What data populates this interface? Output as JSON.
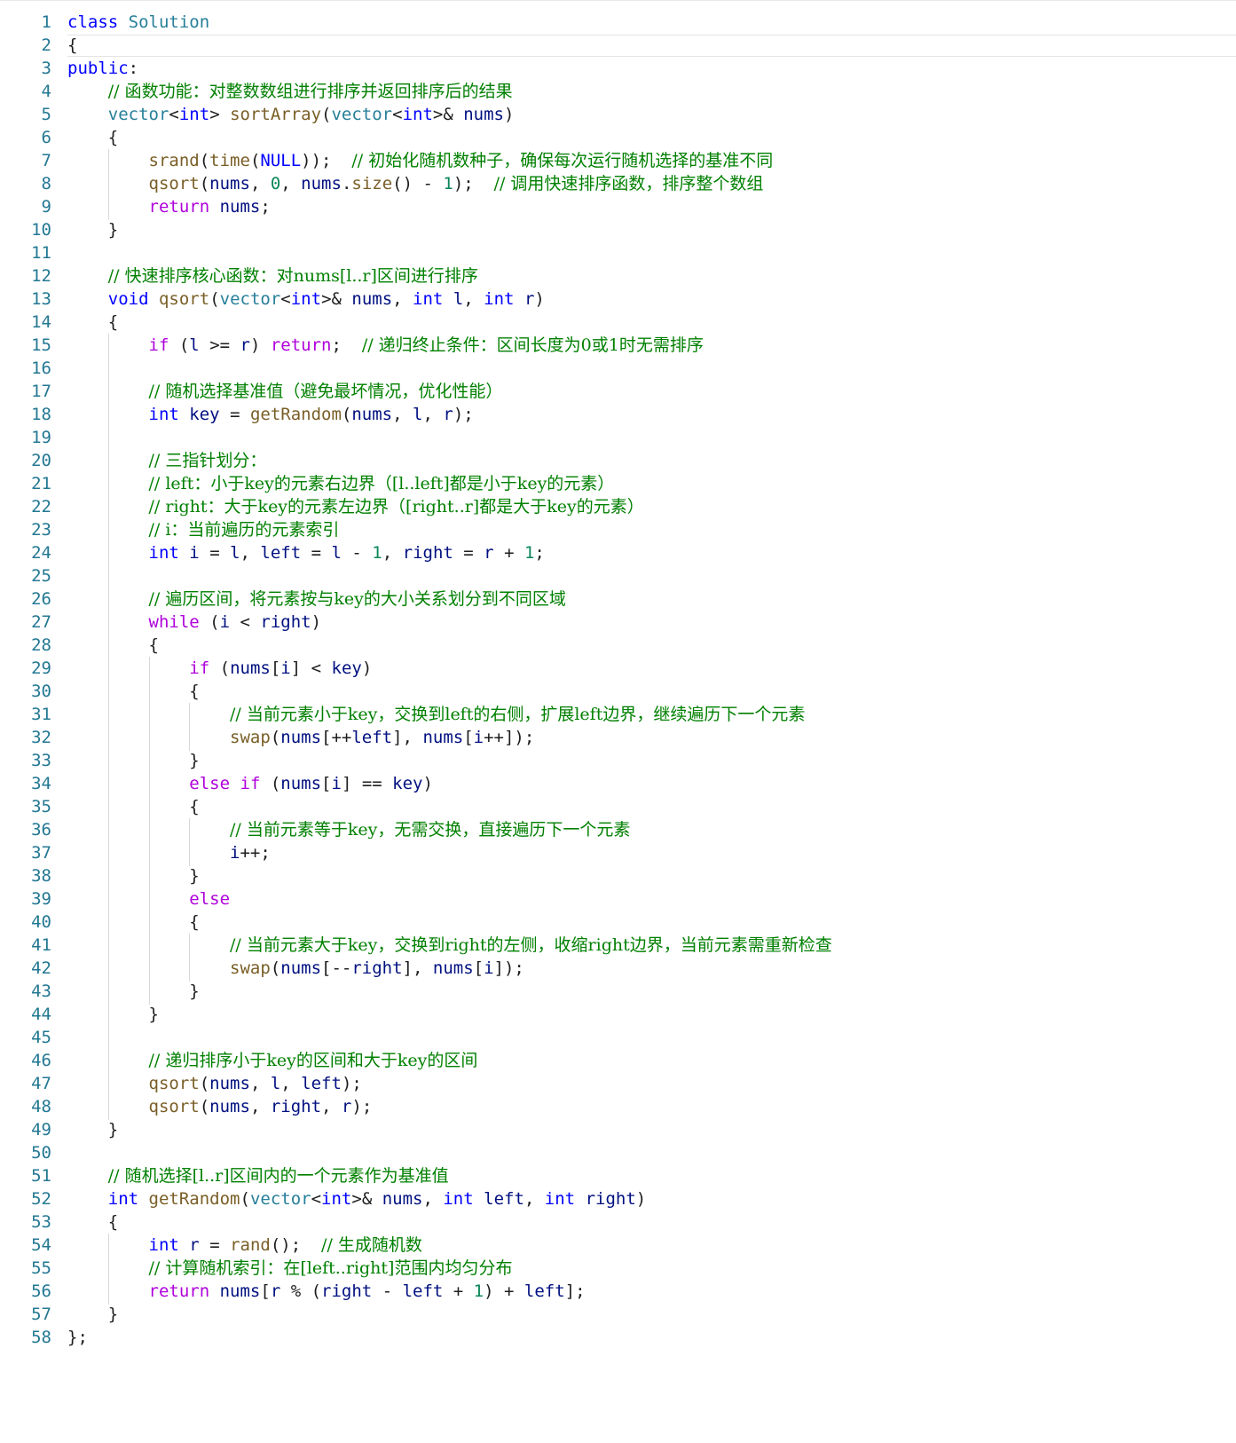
{
  "editor": {
    "lines": [
      [
        [
          "kw",
          "class"
        ],
        [
          "pl",
          " "
        ],
        [
          "ty",
          "Solution"
        ]
      ],
      [
        [
          "pl",
          "{"
        ]
      ],
      [
        [
          "kw",
          "public"
        ],
        [
          "pl",
          ":"
        ]
      ],
      [
        [
          "pl",
          "    "
        ],
        [
          "cm",
          "// 函数功能：对整数数组进行排序并返回排序后的结果"
        ]
      ],
      [
        [
          "pl",
          "    "
        ],
        [
          "ty",
          "vector"
        ],
        [
          "pl",
          "<"
        ],
        [
          "kw",
          "int"
        ],
        [
          "pl",
          "> "
        ],
        [
          "fn",
          "sortArray"
        ],
        [
          "pl",
          "("
        ],
        [
          "ty",
          "vector"
        ],
        [
          "pl",
          "<"
        ],
        [
          "kw",
          "int"
        ],
        [
          "pl",
          ">& "
        ],
        [
          "var",
          "nums"
        ],
        [
          "pl",
          ")"
        ]
      ],
      [
        [
          "pl",
          "    {"
        ]
      ],
      [
        [
          "pl",
          "        "
        ],
        [
          "fn",
          "srand"
        ],
        [
          "pl",
          "("
        ],
        [
          "fn",
          "time"
        ],
        [
          "pl",
          "("
        ],
        [
          "kw",
          "NULL"
        ],
        [
          "pl",
          "));  "
        ],
        [
          "cm",
          "// 初始化随机数种子，确保每次运行随机选择的基准不同"
        ]
      ],
      [
        [
          "pl",
          "        "
        ],
        [
          "fn",
          "qsort"
        ],
        [
          "pl",
          "("
        ],
        [
          "var",
          "nums"
        ],
        [
          "pl",
          ", "
        ],
        [
          "num",
          "0"
        ],
        [
          "pl",
          ", "
        ],
        [
          "var",
          "nums"
        ],
        [
          "pl",
          "."
        ],
        [
          "fn",
          "size"
        ],
        [
          "pl",
          "() - "
        ],
        [
          "num",
          "1"
        ],
        [
          "pl",
          ");  "
        ],
        [
          "cm",
          "// 调用快速排序函数，排序整个数组"
        ]
      ],
      [
        [
          "pl",
          "        "
        ],
        [
          "ctl",
          "return"
        ],
        [
          "pl",
          " "
        ],
        [
          "var",
          "nums"
        ],
        [
          "pl",
          ";"
        ]
      ],
      [
        [
          "pl",
          "    }"
        ]
      ],
      [],
      [
        [
          "pl",
          "    "
        ],
        [
          "cm",
          "// 快速排序核心函数：对nums[l..r]区间进行排序"
        ]
      ],
      [
        [
          "pl",
          "    "
        ],
        [
          "kw",
          "void"
        ],
        [
          "pl",
          " "
        ],
        [
          "fn",
          "qsort"
        ],
        [
          "pl",
          "("
        ],
        [
          "ty",
          "vector"
        ],
        [
          "pl",
          "<"
        ],
        [
          "kw",
          "int"
        ],
        [
          "pl",
          ">& "
        ],
        [
          "var",
          "nums"
        ],
        [
          "pl",
          ", "
        ],
        [
          "kw",
          "int"
        ],
        [
          "pl",
          " "
        ],
        [
          "var",
          "l"
        ],
        [
          "pl",
          ", "
        ],
        [
          "kw",
          "int"
        ],
        [
          "pl",
          " "
        ],
        [
          "var",
          "r"
        ],
        [
          "pl",
          ")"
        ]
      ],
      [
        [
          "pl",
          "    {"
        ]
      ],
      [
        [
          "pl",
          "        "
        ],
        [
          "ctl",
          "if"
        ],
        [
          "pl",
          " ("
        ],
        [
          "var",
          "l"
        ],
        [
          "pl",
          " >= "
        ],
        [
          "var",
          "r"
        ],
        [
          "pl",
          ") "
        ],
        [
          "ctl",
          "return"
        ],
        [
          "pl",
          ";  "
        ],
        [
          "cm",
          "// 递归终止条件：区间长度为0或1时无需排序"
        ]
      ],
      [],
      [
        [
          "pl",
          "        "
        ],
        [
          "cm",
          "// 随机选择基准值（避免最坏情况，优化性能）"
        ]
      ],
      [
        [
          "pl",
          "        "
        ],
        [
          "kw",
          "int"
        ],
        [
          "pl",
          " "
        ],
        [
          "var",
          "key"
        ],
        [
          "pl",
          " = "
        ],
        [
          "fn",
          "getRandom"
        ],
        [
          "pl",
          "("
        ],
        [
          "var",
          "nums"
        ],
        [
          "pl",
          ", "
        ],
        [
          "var",
          "l"
        ],
        [
          "pl",
          ", "
        ],
        [
          "var",
          "r"
        ],
        [
          "pl",
          ");"
        ]
      ],
      [],
      [
        [
          "pl",
          "        "
        ],
        [
          "cm",
          "// 三指针划分："
        ]
      ],
      [
        [
          "pl",
          "        "
        ],
        [
          "cm",
          "// left：小于key的元素右边界（[l..left]都是小于key的元素）"
        ]
      ],
      [
        [
          "pl",
          "        "
        ],
        [
          "cm",
          "// right：大于key的元素左边界（[right..r]都是大于key的元素）"
        ]
      ],
      [
        [
          "pl",
          "        "
        ],
        [
          "cm",
          "// i：当前遍历的元素索引"
        ]
      ],
      [
        [
          "pl",
          "        "
        ],
        [
          "kw",
          "int"
        ],
        [
          "pl",
          " "
        ],
        [
          "var",
          "i"
        ],
        [
          "pl",
          " = "
        ],
        [
          "var",
          "l"
        ],
        [
          "pl",
          ", "
        ],
        [
          "var",
          "left"
        ],
        [
          "pl",
          " = "
        ],
        [
          "var",
          "l"
        ],
        [
          "pl",
          " - "
        ],
        [
          "num",
          "1"
        ],
        [
          "pl",
          ", "
        ],
        [
          "var",
          "right"
        ],
        [
          "pl",
          " = "
        ],
        [
          "var",
          "r"
        ],
        [
          "pl",
          " + "
        ],
        [
          "num",
          "1"
        ],
        [
          "pl",
          ";"
        ]
      ],
      [],
      [
        [
          "pl",
          "        "
        ],
        [
          "cm",
          "// 遍历区间，将元素按与key的大小关系划分到不同区域"
        ]
      ],
      [
        [
          "pl",
          "        "
        ],
        [
          "ctl",
          "while"
        ],
        [
          "pl",
          " ("
        ],
        [
          "var",
          "i"
        ],
        [
          "pl",
          " < "
        ],
        [
          "var",
          "right"
        ],
        [
          "pl",
          ")"
        ]
      ],
      [
        [
          "pl",
          "        {"
        ]
      ],
      [
        [
          "pl",
          "            "
        ],
        [
          "ctl",
          "if"
        ],
        [
          "pl",
          " ("
        ],
        [
          "var",
          "nums"
        ],
        [
          "pl",
          "["
        ],
        [
          "var",
          "i"
        ],
        [
          "pl",
          "] < "
        ],
        [
          "var",
          "key"
        ],
        [
          "pl",
          ")"
        ]
      ],
      [
        [
          "pl",
          "            {"
        ]
      ],
      [
        [
          "pl",
          "                "
        ],
        [
          "cm",
          "// 当前元素小于key，交换到left的右侧，扩展left边界，继续遍历下一个元素"
        ]
      ],
      [
        [
          "pl",
          "                "
        ],
        [
          "fn",
          "swap"
        ],
        [
          "pl",
          "("
        ],
        [
          "var",
          "nums"
        ],
        [
          "pl",
          "[++"
        ],
        [
          "var",
          "left"
        ],
        [
          "pl",
          "], "
        ],
        [
          "var",
          "nums"
        ],
        [
          "pl",
          "["
        ],
        [
          "var",
          "i"
        ],
        [
          "pl",
          "++]);"
        ]
      ],
      [
        [
          "pl",
          "            }"
        ]
      ],
      [
        [
          "pl",
          "            "
        ],
        [
          "ctl",
          "else"
        ],
        [
          "pl",
          " "
        ],
        [
          "ctl",
          "if"
        ],
        [
          "pl",
          " ("
        ],
        [
          "var",
          "nums"
        ],
        [
          "pl",
          "["
        ],
        [
          "var",
          "i"
        ],
        [
          "pl",
          "] == "
        ],
        [
          "var",
          "key"
        ],
        [
          "pl",
          ")"
        ]
      ],
      [
        [
          "pl",
          "            {"
        ]
      ],
      [
        [
          "pl",
          "                "
        ],
        [
          "cm",
          "// 当前元素等于key，无需交换，直接遍历下一个元素"
        ]
      ],
      [
        [
          "pl",
          "                "
        ],
        [
          "var",
          "i"
        ],
        [
          "pl",
          "++;"
        ]
      ],
      [
        [
          "pl",
          "            }"
        ]
      ],
      [
        [
          "pl",
          "            "
        ],
        [
          "ctl",
          "else"
        ]
      ],
      [
        [
          "pl",
          "            {"
        ]
      ],
      [
        [
          "pl",
          "                "
        ],
        [
          "cm",
          "// 当前元素大于key，交换到right的左侧，收缩right边界，当前元素需重新检查"
        ]
      ],
      [
        [
          "pl",
          "                "
        ],
        [
          "fn",
          "swap"
        ],
        [
          "pl",
          "("
        ],
        [
          "var",
          "nums"
        ],
        [
          "pl",
          "[--"
        ],
        [
          "var",
          "right"
        ],
        [
          "pl",
          "], "
        ],
        [
          "var",
          "nums"
        ],
        [
          "pl",
          "["
        ],
        [
          "var",
          "i"
        ],
        [
          "pl",
          "]);"
        ]
      ],
      [
        [
          "pl",
          "            }"
        ]
      ],
      [
        [
          "pl",
          "        }"
        ]
      ],
      [],
      [
        [
          "pl",
          "        "
        ],
        [
          "cm",
          "// 递归排序小于key的区间和大于key的区间"
        ]
      ],
      [
        [
          "pl",
          "        "
        ],
        [
          "fn",
          "qsort"
        ],
        [
          "pl",
          "("
        ],
        [
          "var",
          "nums"
        ],
        [
          "pl",
          ", "
        ],
        [
          "var",
          "l"
        ],
        [
          "pl",
          ", "
        ],
        [
          "var",
          "left"
        ],
        [
          "pl",
          ");"
        ]
      ],
      [
        [
          "pl",
          "        "
        ],
        [
          "fn",
          "qsort"
        ],
        [
          "pl",
          "("
        ],
        [
          "var",
          "nums"
        ],
        [
          "pl",
          ", "
        ],
        [
          "var",
          "right"
        ],
        [
          "pl",
          ", "
        ],
        [
          "var",
          "r"
        ],
        [
          "pl",
          ");"
        ]
      ],
      [
        [
          "pl",
          "    }"
        ]
      ],
      [],
      [
        [
          "pl",
          "    "
        ],
        [
          "cm",
          "// 随机选择[l..r]区间内的一个元素作为基准值"
        ]
      ],
      [
        [
          "pl",
          "    "
        ],
        [
          "kw",
          "int"
        ],
        [
          "pl",
          " "
        ],
        [
          "fn",
          "getRandom"
        ],
        [
          "pl",
          "("
        ],
        [
          "ty",
          "vector"
        ],
        [
          "pl",
          "<"
        ],
        [
          "kw",
          "int"
        ],
        [
          "pl",
          ">& "
        ],
        [
          "var",
          "nums"
        ],
        [
          "pl",
          ", "
        ],
        [
          "kw",
          "int"
        ],
        [
          "pl",
          " "
        ],
        [
          "var",
          "left"
        ],
        [
          "pl",
          ", "
        ],
        [
          "kw",
          "int"
        ],
        [
          "pl",
          " "
        ],
        [
          "var",
          "right"
        ],
        [
          "pl",
          ")"
        ]
      ],
      [
        [
          "pl",
          "    {"
        ]
      ],
      [
        [
          "pl",
          "        "
        ],
        [
          "kw",
          "int"
        ],
        [
          "pl",
          " "
        ],
        [
          "var",
          "r"
        ],
        [
          "pl",
          " = "
        ],
        [
          "fn",
          "rand"
        ],
        [
          "pl",
          "();  "
        ],
        [
          "cm",
          "// 生成随机数"
        ]
      ],
      [
        [
          "pl",
          "        "
        ],
        [
          "cm",
          "// 计算随机索引：在[left..right]范围内均匀分布"
        ]
      ],
      [
        [
          "pl",
          "        "
        ],
        [
          "ctl",
          "return"
        ],
        [
          "pl",
          " "
        ],
        [
          "var",
          "nums"
        ],
        [
          "pl",
          "["
        ],
        [
          "var",
          "r"
        ],
        [
          "pl",
          " % ("
        ],
        [
          "var",
          "right"
        ],
        [
          "pl",
          " - "
        ],
        [
          "var",
          "left"
        ],
        [
          "pl",
          " + "
        ],
        [
          "num",
          "1"
        ],
        [
          "pl",
          ") + "
        ],
        [
          "var",
          "left"
        ],
        [
          "pl",
          "];"
        ]
      ],
      [
        [
          "pl",
          "    }"
        ]
      ],
      [
        [
          "pl",
          "};"
        ]
      ]
    ]
  }
}
